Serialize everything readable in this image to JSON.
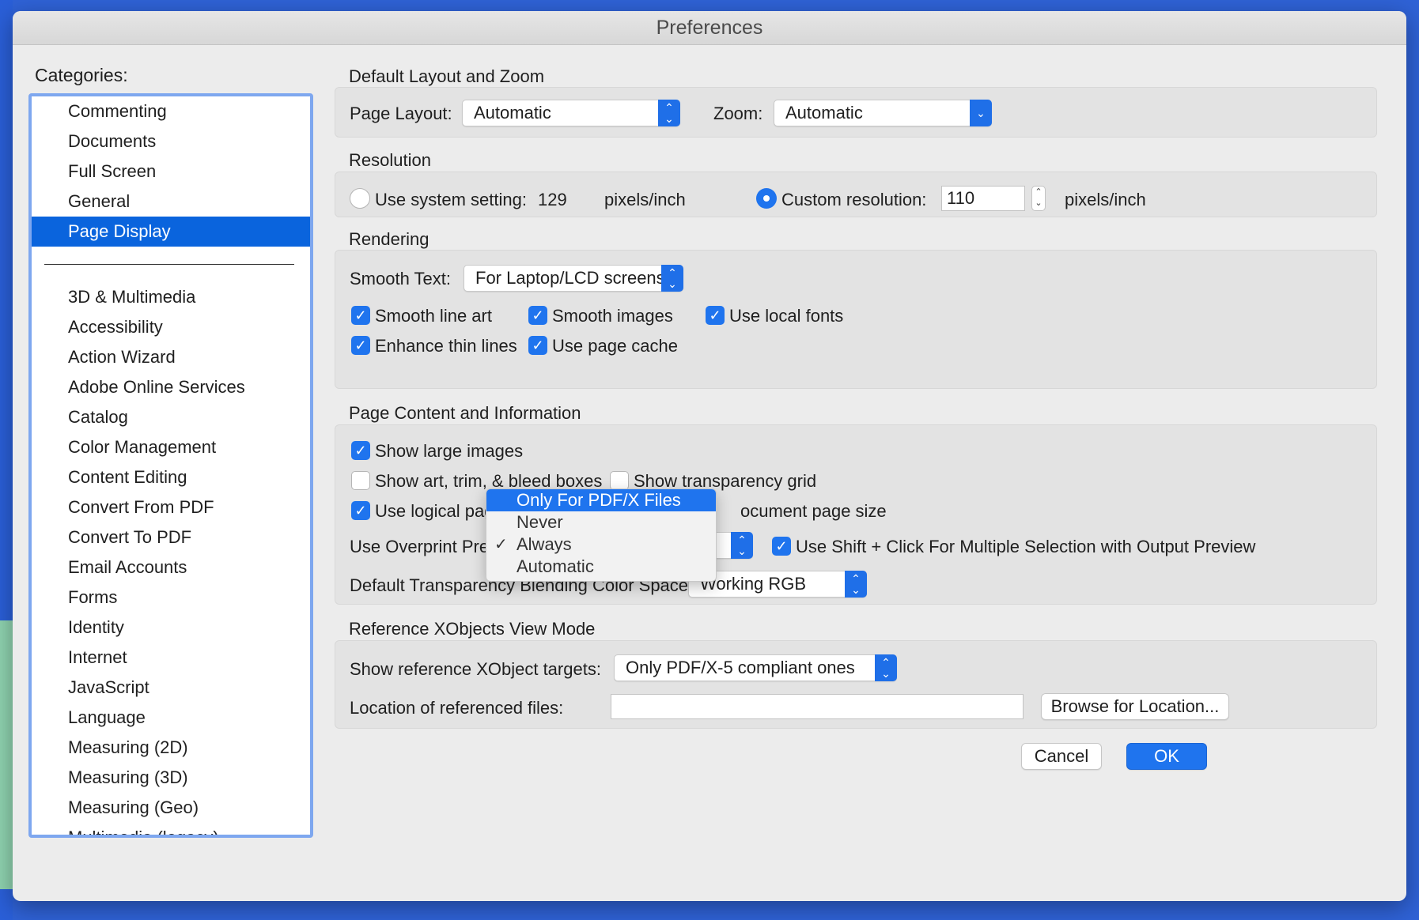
{
  "window": {
    "title": "Preferences"
  },
  "categories": {
    "label": "Categories:",
    "top_items": [
      "Commenting",
      "Documents",
      "Full Screen",
      "General",
      "Page Display"
    ],
    "selected": "Page Display",
    "other_items": [
      "3D & Multimedia",
      "Accessibility",
      "Action Wizard",
      "Adobe Online Services",
      "Catalog",
      "Color Management",
      "Content Editing",
      "Convert From PDF",
      "Convert To PDF",
      "Email Accounts",
      "Forms",
      "Identity",
      "Internet",
      "JavaScript",
      "Language",
      "Measuring (2D)",
      "Measuring (3D)",
      "Measuring (Geo)",
      "Multimedia (legacy)"
    ]
  },
  "layout_zoom": {
    "title": "Default Layout and Zoom",
    "page_layout_label": "Page Layout:",
    "page_layout_value": "Automatic",
    "zoom_label": "Zoom:",
    "zoom_value": "Automatic"
  },
  "resolution": {
    "title": "Resolution",
    "system_label": "Use system setting:",
    "system_value": "129",
    "system_unit": "pixels/inch",
    "custom_label": "Custom resolution:",
    "custom_value": "110",
    "custom_unit": "pixels/inch",
    "selected": "custom"
  },
  "rendering": {
    "title": "Rendering",
    "smooth_text_label": "Smooth Text:",
    "smooth_text_value": "For Laptop/LCD screens",
    "smooth_line_art": "Smooth line art",
    "smooth_images": "Smooth images",
    "use_local_fonts": "Use local fonts",
    "enhance_thin_lines": "Enhance thin lines",
    "use_page_cache": "Use page cache"
  },
  "page_content": {
    "title": "Page Content and Information",
    "show_large_images": "Show large images",
    "show_art_trim": "Show art, trim, & bleed boxes",
    "show_transparency_grid": "Show transparency grid",
    "use_logical_page": "Use logical page nu",
    "document_page_size": "ocument page size",
    "overprint_label": "Use Overprint Preview:",
    "shift_click": "Use Shift + Click For Multiple Selection with Output Preview",
    "blending_label": "Default Transparency Blending Color Space:",
    "blending_value": "Working RGB"
  },
  "overprint_menu": {
    "options": [
      "Only For PDF/X Files",
      "Never",
      "Always",
      "Automatic"
    ],
    "highlighted": "Only For PDF/X Files",
    "checked": "Always",
    "check_mark": "✓"
  },
  "xobjects": {
    "title": "Reference XObjects View Mode",
    "targets_label": "Show reference XObject targets:",
    "targets_value": "Only PDF/X-5 compliant ones",
    "location_label": "Location of referenced files:",
    "location_value": "",
    "browse_button": "Browse for Location..."
  },
  "footer": {
    "cancel": "Cancel",
    "ok": "OK"
  },
  "colors": {
    "accent": "#1f74ee",
    "selection": "#0a64dd",
    "desktop": "#2f62d6"
  }
}
